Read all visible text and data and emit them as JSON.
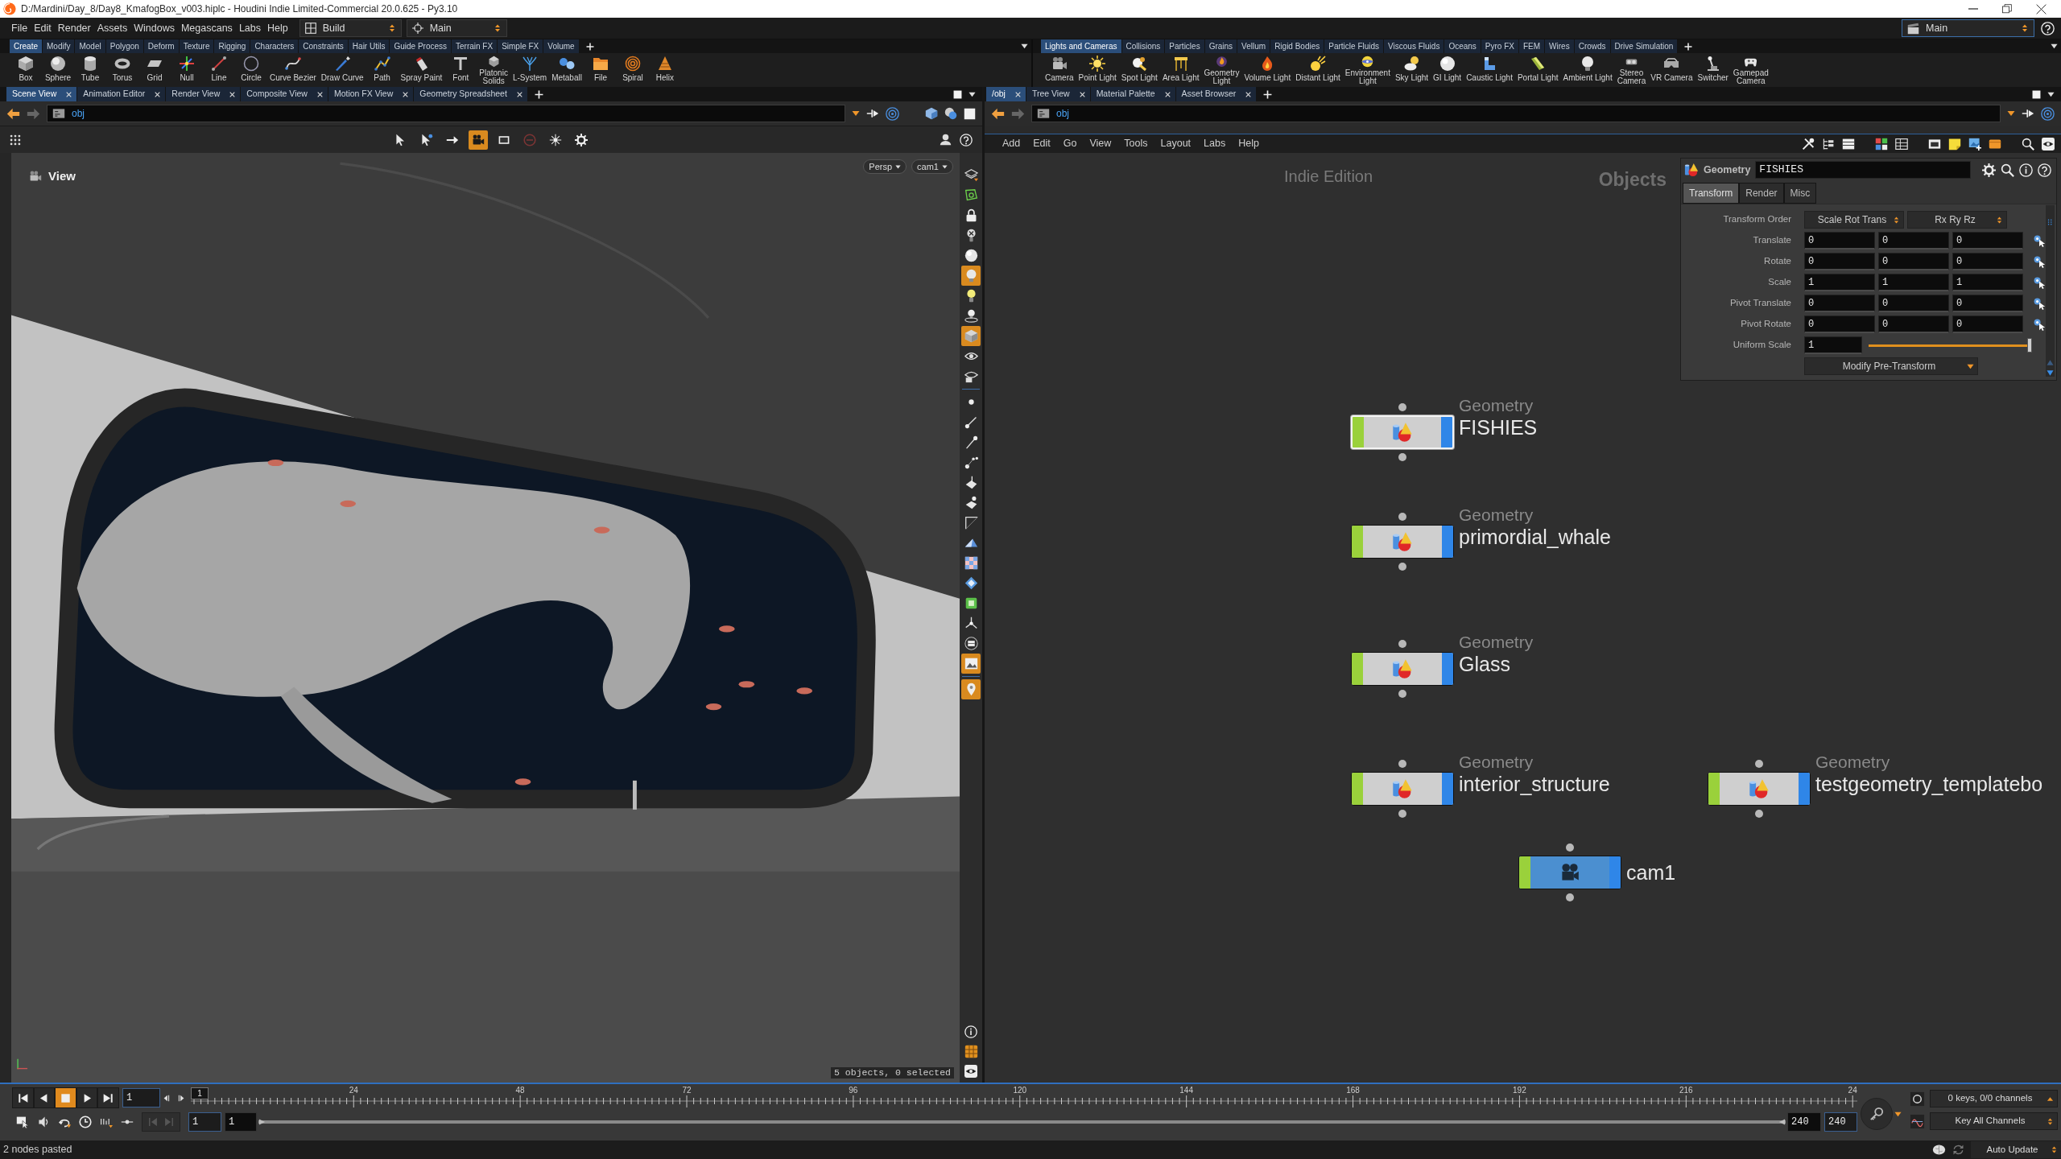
{
  "window": {
    "title": "D:/Mardini/Day_8/Day8_KmafogBox_v003.hiplc - Houdini Indie Limited-Commercial 20.0.625 - Py3.10"
  },
  "menu_bar": {
    "items": [
      "File",
      "Edit",
      "Render",
      "Assets",
      "Windows",
      "Megascans",
      "Labs",
      "Help"
    ],
    "desktop": "Build",
    "layout": "Main",
    "right_layout": "Main"
  },
  "shelves": [
    {
      "tabs": [
        {
          "label": "Create",
          "selected": true
        },
        {
          "label": "Modify",
          "selected": false
        },
        {
          "label": "Model",
          "selected": false
        },
        {
          "label": "Polygon",
          "selected": false
        },
        {
          "label": "Deform",
          "selected": false
        },
        {
          "label": "Texture",
          "selected": false
        },
        {
          "label": "Rigging",
          "selected": false
        },
        {
          "label": "Characters",
          "selected": false
        },
        {
          "label": "Constraints",
          "selected": false
        },
        {
          "label": "Hair Utils",
          "selected": false
        },
        {
          "label": "Guide Process",
          "selected": false
        },
        {
          "label": "Terrain FX",
          "selected": false
        },
        {
          "label": "Simple FX",
          "selected": false
        },
        {
          "label": "Volume",
          "selected": false
        }
      ],
      "tools": [
        "Box",
        "Sphere",
        "Tube",
        "Torus",
        "Grid",
        "Null",
        "Line",
        "Circle",
        "Curve Bezier",
        "Draw Curve",
        "Path",
        "Spray Paint",
        "Font",
        "Platonic Solids",
        "L-System",
        "Metaball",
        "File",
        "Spiral",
        "Helix"
      ]
    },
    {
      "tabs": [
        {
          "label": "Lights and Cameras",
          "selected": true
        },
        {
          "label": "Collisions",
          "selected": false
        },
        {
          "label": "Particles",
          "selected": false
        },
        {
          "label": "Grains",
          "selected": false
        },
        {
          "label": "Vellum",
          "selected": false
        },
        {
          "label": "Rigid Bodies",
          "selected": false
        },
        {
          "label": "Particle Fluids",
          "selected": false
        },
        {
          "label": "Viscous Fluids",
          "selected": false
        },
        {
          "label": "Oceans",
          "selected": false
        },
        {
          "label": "Pyro FX",
          "selected": false
        },
        {
          "label": "FEM",
          "selected": false
        },
        {
          "label": "Wires",
          "selected": false
        },
        {
          "label": "Crowds",
          "selected": false
        },
        {
          "label": "Drive Simulation",
          "selected": false
        }
      ],
      "tools": [
        "Camera",
        "Point Light",
        "Spot Light",
        "Area Light",
        "Geometry Light",
        "Volume Light",
        "Distant Light",
        "Environment Light",
        "Sky Light",
        "GI Light",
        "Caustic Light",
        "Portal Light",
        "Ambient Light",
        "Stereo Camera",
        "VR Camera",
        "Switcher",
        "Gamepad Camera"
      ]
    }
  ],
  "scene_view": {
    "tabs": [
      {
        "label": "Scene View",
        "selected": true
      },
      {
        "label": "Animation Editor",
        "selected": false
      },
      {
        "label": "Render View",
        "selected": false
      },
      {
        "label": "Composite View",
        "selected": false
      },
      {
        "label": "Motion FX View",
        "selected": false
      },
      {
        "label": "Geometry Spreadsheet",
        "selected": false
      }
    ],
    "path": "obj",
    "top_toolbar": [
      {
        "on": false
      },
      {
        "on": false
      },
      {
        "on": false
      },
      {
        "on": true
      },
      {
        "on": false
      },
      {
        "on": false
      },
      {
        "on": false
      },
      {
        "on": false
      }
    ],
    "view_label": "View",
    "camera_menus": [
      "Persp",
      "cam1"
    ],
    "side_toolbar": [
      {
        "on": false
      },
      {
        "on": false
      },
      {
        "on": false
      },
      {
        "on": false
      },
      {
        "on": false
      },
      {
        "on": true
      },
      {
        "on": false
      },
      {
        "on": false
      },
      {
        "on": true
      },
      {
        "on": false
      },
      {
        "on": false
      },
      {
        "on": false
      },
      {
        "on": false
      },
      {
        "on": false
      },
      {
        "on": false
      },
      {
        "on": false
      },
      {
        "on": false
      },
      {
        "on": false
      },
      {
        "on": false
      },
      {
        "on": false
      },
      {
        "on": false
      },
      {
        "on": false
      },
      {
        "on": false
      },
      {
        "on": false
      },
      {
        "on": true
      },
      {
        "on": true
      }
    ],
    "status": "5 objects, 0 selected"
  },
  "network_view": {
    "tabs": [
      {
        "label": "/obj",
        "selected": true
      },
      {
        "label": "Tree View",
        "selected": false
      },
      {
        "label": "Material Palette",
        "selected": false
      },
      {
        "label": "Asset Browser",
        "selected": false
      }
    ],
    "path": "obj",
    "menu": [
      "Add",
      "Edit",
      "Go",
      "View",
      "Tools",
      "Layout",
      "Labs",
      "Help"
    ],
    "edition_label": "Indie Edition",
    "context_label": "Objects",
    "nodes": [
      {
        "type": "Geometry",
        "name": "FISHIES",
        "kind": "geometry",
        "selected": true,
        "display": true
      },
      {
        "type": "Geometry",
        "name": "primordial_whale",
        "kind": "geometry",
        "selected": false,
        "display": true
      },
      {
        "type": "Geometry",
        "name": "Glass",
        "kind": "geometry",
        "selected": false,
        "display": true
      },
      {
        "type": "Geometry",
        "name": "interior_structure",
        "kind": "geometry",
        "selected": false,
        "display": true
      },
      {
        "type": "Geometry",
        "name": "testgeometry_templatebo",
        "kind": "geometry",
        "selected": false,
        "display": true
      },
      {
        "name": "cam1",
        "kind": "camera",
        "selected": false,
        "display": true
      }
    ],
    "parameters": {
      "type": "Geometry",
      "name": "FISHIES",
      "tabs": [
        {
          "label": "Transform",
          "selected": true
        },
        {
          "label": "Render",
          "selected": false
        },
        {
          "label": "Misc",
          "selected": false
        }
      ],
      "rows": [
        {
          "kind": "menus",
          "label": "Transform Order",
          "values": [
            "Scale Rot Trans",
            "Rx Ry Rz"
          ]
        },
        {
          "kind": "vector",
          "label": "Translate",
          "values": [
            "0",
            "0",
            "0"
          ]
        },
        {
          "kind": "vector",
          "label": "Rotate",
          "values": [
            "0",
            "0",
            "0"
          ]
        },
        {
          "kind": "vector",
          "label": "Scale",
          "values": [
            "1",
            "1",
            "1"
          ]
        },
        {
          "kind": "vector",
          "label": "Pivot Translate",
          "values": [
            "0",
            "0",
            "0"
          ]
        },
        {
          "kind": "vector",
          "label": "Pivot Rotate",
          "values": [
            "0",
            "0",
            "0"
          ]
        },
        {
          "kind": "slider",
          "label": "Uniform Scale",
          "value": "1",
          "level": 1
        },
        {
          "kind": "menu_button",
          "label": "Modify Pre-Transform"
        }
      ]
    }
  },
  "timeline": {
    "playback": [
      {
        "selected": false
      },
      {
        "selected": false
      },
      {
        "selected": true
      },
      {
        "selected": false
      },
      {
        "selected": false
      }
    ],
    "frame": "1",
    "current_frame": "1",
    "ruler_labels": [
      "24",
      "48",
      "72",
      "96",
      "120",
      "144",
      "168",
      "192",
      "216",
      "24"
    ],
    "key_nav": [
      {
        "disabled": true
      },
      {
        "disabled": true
      }
    ],
    "start": "1",
    "range_start": "1",
    "range": {
      "level": 1
    },
    "range_end": "240",
    "end": "240",
    "keys_status": "0 keys, 0/0 channels",
    "key_mode": "Key All Channels"
  },
  "status_bar": {
    "message": "2 nodes pasted",
    "update_mode": "Auto Update"
  }
}
